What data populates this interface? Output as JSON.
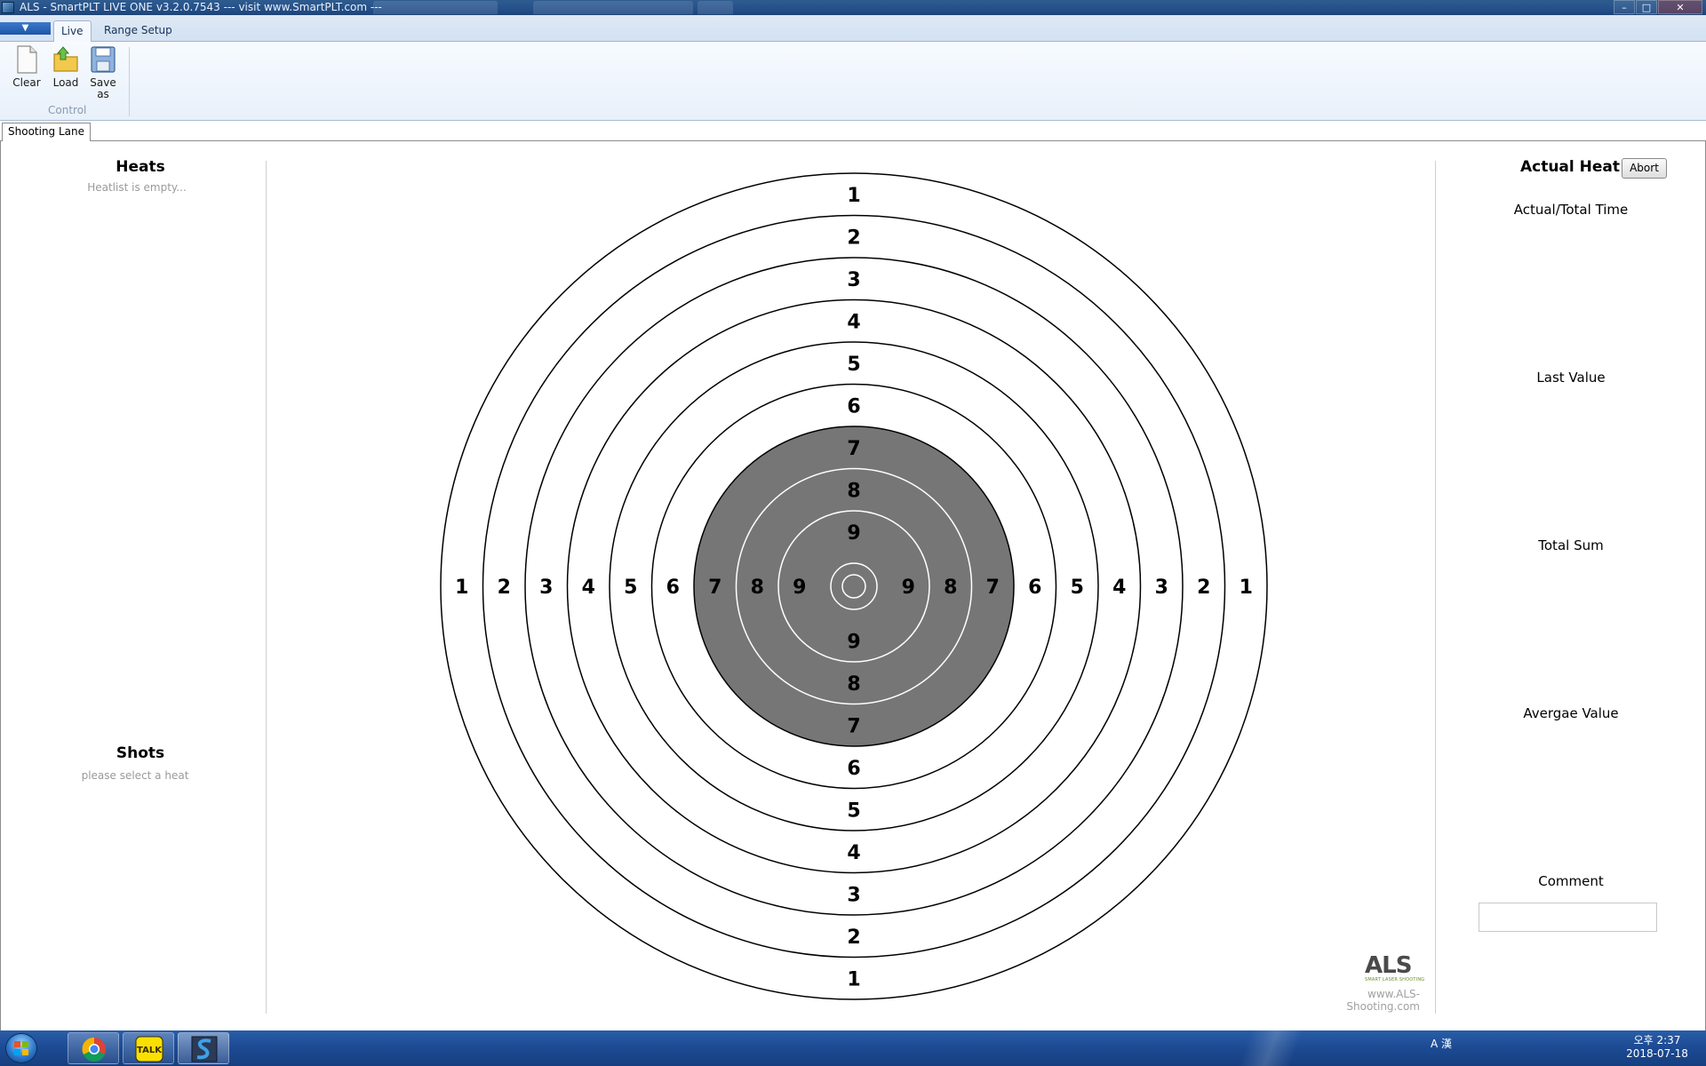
{
  "window": {
    "title": "ALS - SmartPLT LIVE  ONE  v3.2.0.7543   --- visit www.SmartPLT.com ---",
    "minimize": "–",
    "maximize": "□",
    "close": "✕"
  },
  "ribbon": {
    "tabs": [
      {
        "label": "Live"
      },
      {
        "label": "Range Setup"
      }
    ],
    "buttons": [
      {
        "label": "Clear",
        "icon": "document-icon"
      },
      {
        "label": "Load",
        "icon": "folder-icon"
      },
      {
        "label": "Save as",
        "icon": "save-icon"
      }
    ],
    "group_label": "Control"
  },
  "doc_tab": {
    "label": "Shooting Lane"
  },
  "left_panel": {
    "heats_title": "Heats",
    "heats_empty": "Heatlist is empty...",
    "shots_title": "Shots",
    "shots_hint": "please select a heat"
  },
  "target": {
    "ring_labels": [
      "1",
      "2",
      "3",
      "4",
      "5",
      "6",
      "7",
      "8",
      "9"
    ],
    "black_from_ring": 7,
    "colors": {
      "ring": "#000000",
      "black": "#767676",
      "paper": "#ffffff",
      "inner_line": "#ffffff"
    }
  },
  "right_panel": {
    "title": "Actual Heat",
    "abort_label": "Abort",
    "actual_total_time": "Actual/Total Time",
    "last_value": "Last Value",
    "total_sum": "Total Sum",
    "average_value": "Avergae Value",
    "comment": "Comment"
  },
  "branding": {
    "logo": "ALS",
    "logo_sub": "SMART LASER SHOOTING",
    "website": "www.ALS-Shooting.com"
  },
  "taskbar": {
    "apps": [
      {
        "name": "chrome",
        "icon": "chrome-icon"
      },
      {
        "name": "kakaotalk",
        "icon": "talk-icon",
        "label": "TALK"
      },
      {
        "name": "smartplt",
        "icon": "smartplt-icon"
      }
    ],
    "tray_text": "A 漢",
    "time": "오후 2:37",
    "date": "2018-07-18"
  }
}
